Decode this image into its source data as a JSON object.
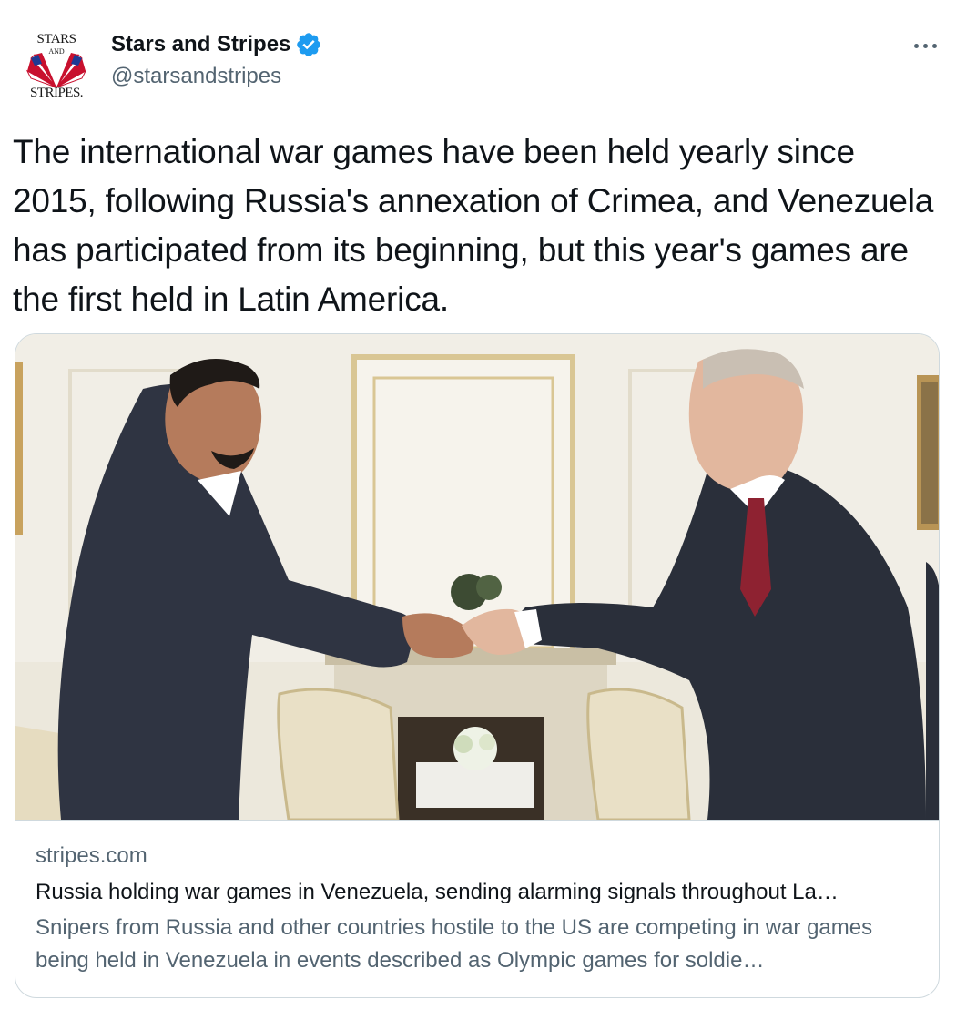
{
  "account": {
    "display_name": "Stars and Stripes",
    "handle": "@starsandstripes",
    "verified": true,
    "avatar_logo": {
      "top": "STARS",
      "middle": "AND",
      "bottom": "STRIPES."
    },
    "verified_color": "#1d9bf0"
  },
  "tweet": {
    "text": "The international war games have been held yearly since 2015, following Russia's annexation of Crimea, and Venezuela has participated from its beginning, but this year's games are the first held in Latin America."
  },
  "card": {
    "image_icon": "handshake-photo",
    "domain": "stripes.com",
    "title": "Russia holding war games in Venezuela, sending alarming signals throughout La…",
    "description": "Snipers from Russia and other countries hostile to the US are competing in war games being held in Venezuela in events described as Olympic games for soldie…"
  },
  "icons": {
    "more": "more-horizontal-icon",
    "verified": "verified-badge-icon"
  }
}
